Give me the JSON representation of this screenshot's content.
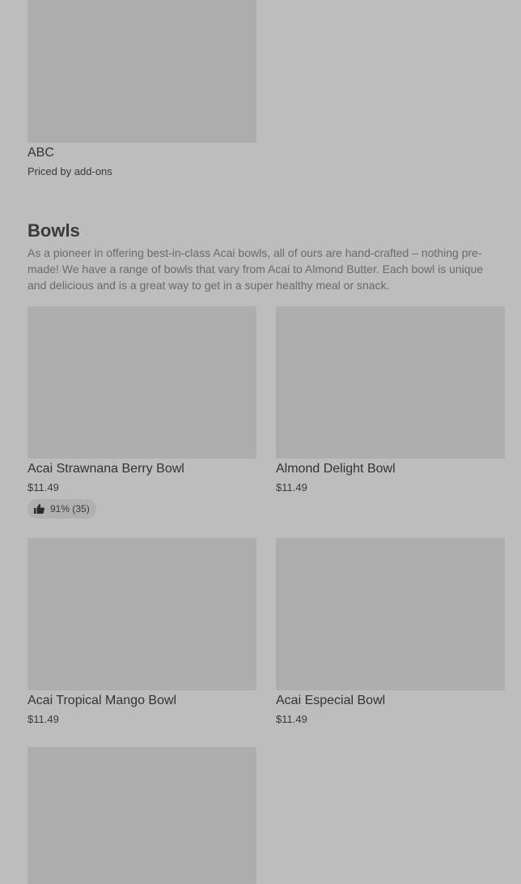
{
  "top_item": {
    "name": "ABC",
    "price": "Priced by add-ons"
  },
  "section": {
    "title": "Bowls",
    "description": "As a pioneer in offering best-in-class Acai bowls, all of ours are hand-crafted – nothing pre-made! We have a range of bowls that vary from Acai to Almond Butter. Each bowl is unique and delicious and is a great way to get in a super healthy meal or snack."
  },
  "items": [
    {
      "name": "Acai Strawnana Berry Bowl",
      "price": "$11.49",
      "rating": "91% (35)"
    },
    {
      "name": "Almond Delight Bowl",
      "price": "$11.49"
    },
    {
      "name": "Acai Tropical Mango Bowl",
      "price": "$11.49"
    },
    {
      "name": "Acai Especial Bowl",
      "price": "$11.49"
    }
  ],
  "icons": {
    "rating": "thumbs-up-icon"
  },
  "colors": {
    "overlay_background": "#bdbdbd",
    "image_placeholder": "#adadad"
  }
}
